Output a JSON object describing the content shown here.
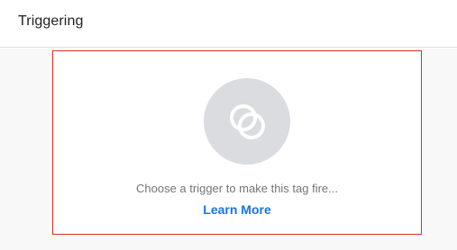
{
  "header": {
    "title": "Triggering"
  },
  "trigger_box": {
    "icon": "trigger-icon",
    "hint": "Choose a trigger to make this tag fire...",
    "learn_more": "Learn More"
  },
  "colors": {
    "border": "#d93025",
    "icon_bg": "#dadce0",
    "link": "#1a73e8"
  }
}
